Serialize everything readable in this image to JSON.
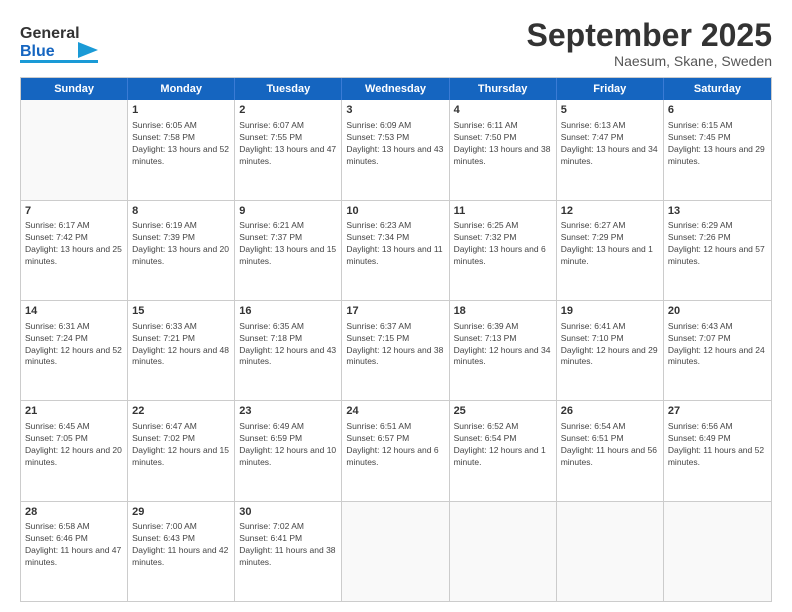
{
  "header": {
    "logo_general": "General",
    "logo_blue": "Blue",
    "month_title": "September 2025",
    "location": "Naesum, Skane, Sweden"
  },
  "weekdays": [
    "Sunday",
    "Monday",
    "Tuesday",
    "Wednesday",
    "Thursday",
    "Friday",
    "Saturday"
  ],
  "rows": [
    [
      {
        "day": "",
        "sunrise": "",
        "sunset": "",
        "daylight": "",
        "empty": true
      },
      {
        "day": "1",
        "sunrise": "Sunrise: 6:05 AM",
        "sunset": "Sunset: 7:58 PM",
        "daylight": "Daylight: 13 hours and 52 minutes."
      },
      {
        "day": "2",
        "sunrise": "Sunrise: 6:07 AM",
        "sunset": "Sunset: 7:55 PM",
        "daylight": "Daylight: 13 hours and 47 minutes."
      },
      {
        "day": "3",
        "sunrise": "Sunrise: 6:09 AM",
        "sunset": "Sunset: 7:53 PM",
        "daylight": "Daylight: 13 hours and 43 minutes."
      },
      {
        "day": "4",
        "sunrise": "Sunrise: 6:11 AM",
        "sunset": "Sunset: 7:50 PM",
        "daylight": "Daylight: 13 hours and 38 minutes."
      },
      {
        "day": "5",
        "sunrise": "Sunrise: 6:13 AM",
        "sunset": "Sunset: 7:47 PM",
        "daylight": "Daylight: 13 hours and 34 minutes."
      },
      {
        "day": "6",
        "sunrise": "Sunrise: 6:15 AM",
        "sunset": "Sunset: 7:45 PM",
        "daylight": "Daylight: 13 hours and 29 minutes."
      }
    ],
    [
      {
        "day": "7",
        "sunrise": "Sunrise: 6:17 AM",
        "sunset": "Sunset: 7:42 PM",
        "daylight": "Daylight: 13 hours and 25 minutes."
      },
      {
        "day": "8",
        "sunrise": "Sunrise: 6:19 AM",
        "sunset": "Sunset: 7:39 PM",
        "daylight": "Daylight: 13 hours and 20 minutes."
      },
      {
        "day": "9",
        "sunrise": "Sunrise: 6:21 AM",
        "sunset": "Sunset: 7:37 PM",
        "daylight": "Daylight: 13 hours and 15 minutes."
      },
      {
        "day": "10",
        "sunrise": "Sunrise: 6:23 AM",
        "sunset": "Sunset: 7:34 PM",
        "daylight": "Daylight: 13 hours and 11 minutes."
      },
      {
        "day": "11",
        "sunrise": "Sunrise: 6:25 AM",
        "sunset": "Sunset: 7:32 PM",
        "daylight": "Daylight: 13 hours and 6 minutes."
      },
      {
        "day": "12",
        "sunrise": "Sunrise: 6:27 AM",
        "sunset": "Sunset: 7:29 PM",
        "daylight": "Daylight: 13 hours and 1 minute."
      },
      {
        "day": "13",
        "sunrise": "Sunrise: 6:29 AM",
        "sunset": "Sunset: 7:26 PM",
        "daylight": "Daylight: 12 hours and 57 minutes."
      }
    ],
    [
      {
        "day": "14",
        "sunrise": "Sunrise: 6:31 AM",
        "sunset": "Sunset: 7:24 PM",
        "daylight": "Daylight: 12 hours and 52 minutes."
      },
      {
        "day": "15",
        "sunrise": "Sunrise: 6:33 AM",
        "sunset": "Sunset: 7:21 PM",
        "daylight": "Daylight: 12 hours and 48 minutes."
      },
      {
        "day": "16",
        "sunrise": "Sunrise: 6:35 AM",
        "sunset": "Sunset: 7:18 PM",
        "daylight": "Daylight: 12 hours and 43 minutes."
      },
      {
        "day": "17",
        "sunrise": "Sunrise: 6:37 AM",
        "sunset": "Sunset: 7:15 PM",
        "daylight": "Daylight: 12 hours and 38 minutes."
      },
      {
        "day": "18",
        "sunrise": "Sunrise: 6:39 AM",
        "sunset": "Sunset: 7:13 PM",
        "daylight": "Daylight: 12 hours and 34 minutes."
      },
      {
        "day": "19",
        "sunrise": "Sunrise: 6:41 AM",
        "sunset": "Sunset: 7:10 PM",
        "daylight": "Daylight: 12 hours and 29 minutes."
      },
      {
        "day": "20",
        "sunrise": "Sunrise: 6:43 AM",
        "sunset": "Sunset: 7:07 PM",
        "daylight": "Daylight: 12 hours and 24 minutes."
      }
    ],
    [
      {
        "day": "21",
        "sunrise": "Sunrise: 6:45 AM",
        "sunset": "Sunset: 7:05 PM",
        "daylight": "Daylight: 12 hours and 20 minutes."
      },
      {
        "day": "22",
        "sunrise": "Sunrise: 6:47 AM",
        "sunset": "Sunset: 7:02 PM",
        "daylight": "Daylight: 12 hours and 15 minutes."
      },
      {
        "day": "23",
        "sunrise": "Sunrise: 6:49 AM",
        "sunset": "Sunset: 6:59 PM",
        "daylight": "Daylight: 12 hours and 10 minutes."
      },
      {
        "day": "24",
        "sunrise": "Sunrise: 6:51 AM",
        "sunset": "Sunset: 6:57 PM",
        "daylight": "Daylight: 12 hours and 6 minutes."
      },
      {
        "day": "25",
        "sunrise": "Sunrise: 6:52 AM",
        "sunset": "Sunset: 6:54 PM",
        "daylight": "Daylight: 12 hours and 1 minute."
      },
      {
        "day": "26",
        "sunrise": "Sunrise: 6:54 AM",
        "sunset": "Sunset: 6:51 PM",
        "daylight": "Daylight: 11 hours and 56 minutes."
      },
      {
        "day": "27",
        "sunrise": "Sunrise: 6:56 AM",
        "sunset": "Sunset: 6:49 PM",
        "daylight": "Daylight: 11 hours and 52 minutes."
      }
    ],
    [
      {
        "day": "28",
        "sunrise": "Sunrise: 6:58 AM",
        "sunset": "Sunset: 6:46 PM",
        "daylight": "Daylight: 11 hours and 47 minutes."
      },
      {
        "day": "29",
        "sunrise": "Sunrise: 7:00 AM",
        "sunset": "Sunset: 6:43 PM",
        "daylight": "Daylight: 11 hours and 42 minutes."
      },
      {
        "day": "30",
        "sunrise": "Sunrise: 7:02 AM",
        "sunset": "Sunset: 6:41 PM",
        "daylight": "Daylight: 11 hours and 38 minutes."
      },
      {
        "day": "",
        "sunrise": "",
        "sunset": "",
        "daylight": "",
        "empty": true
      },
      {
        "day": "",
        "sunrise": "",
        "sunset": "",
        "daylight": "",
        "empty": true
      },
      {
        "day": "",
        "sunrise": "",
        "sunset": "",
        "daylight": "",
        "empty": true
      },
      {
        "day": "",
        "sunrise": "",
        "sunset": "",
        "daylight": "",
        "empty": true
      }
    ]
  ]
}
